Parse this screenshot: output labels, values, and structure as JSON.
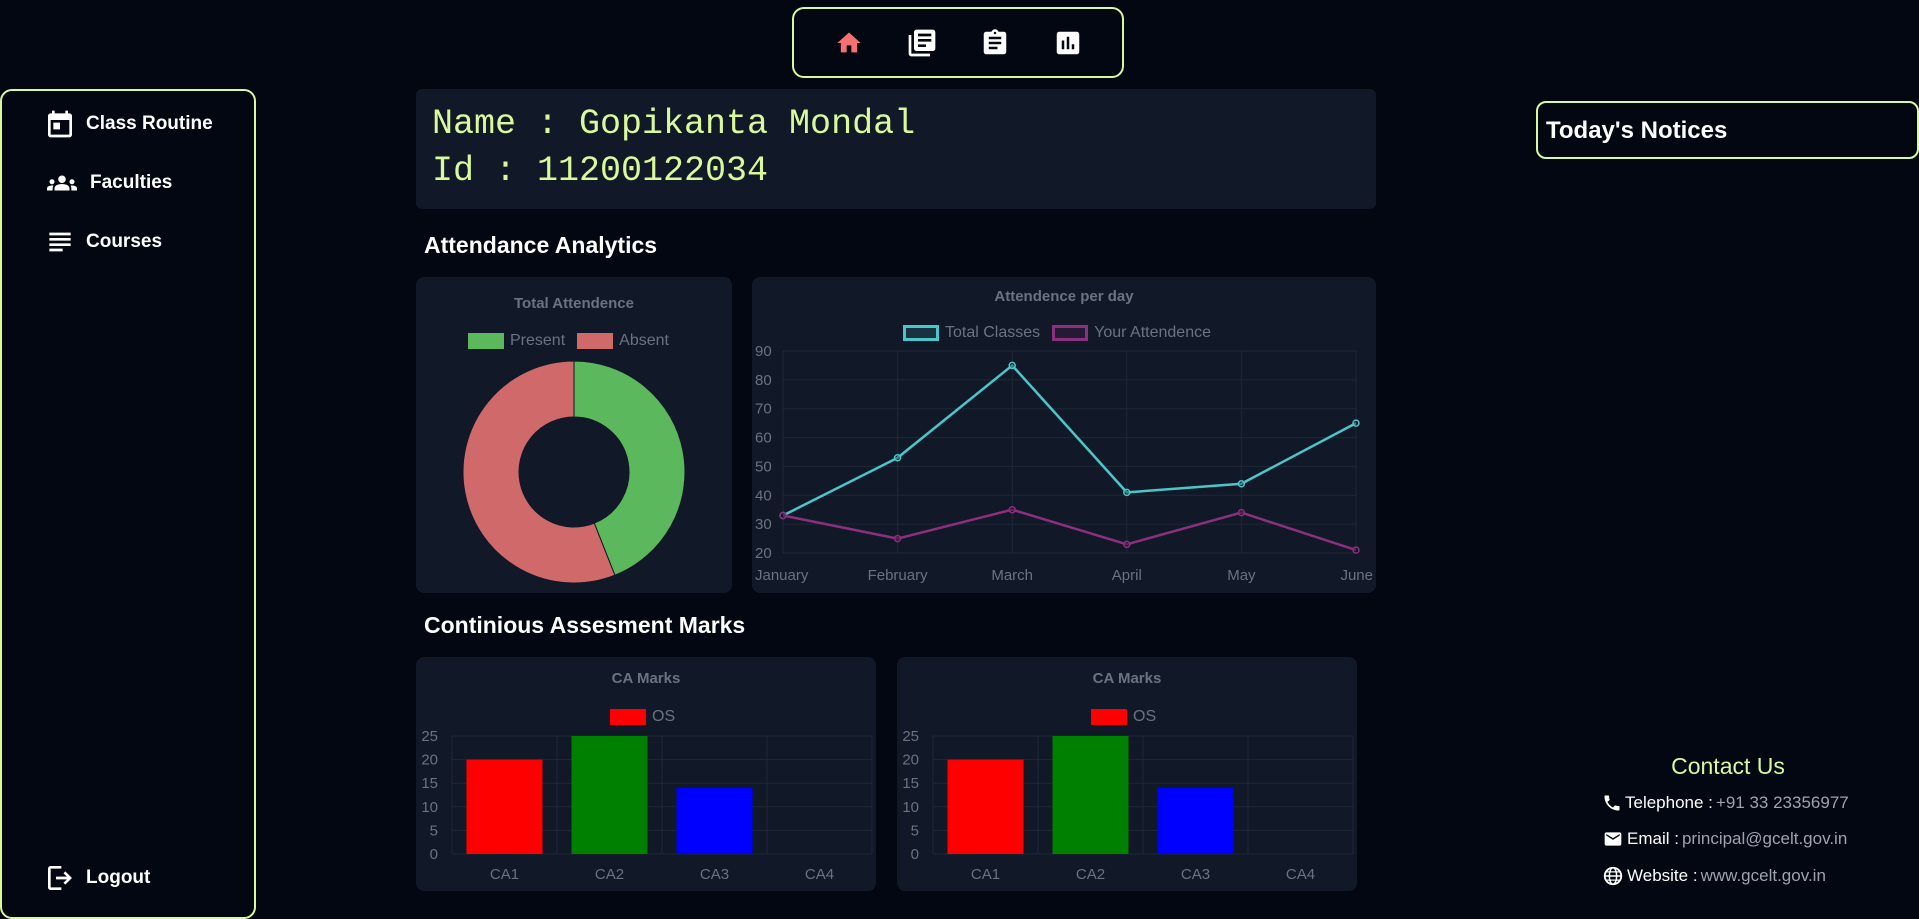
{
  "nav": {
    "icons": [
      "home-icon",
      "library-books-icon",
      "clipboard-icon",
      "bar-chart-icon"
    ],
    "active_color": "#f87171"
  },
  "sidebar": {
    "items": [
      {
        "label": "Class Routine",
        "icon": "calendar-icon"
      },
      {
        "label": "Faculties",
        "icon": "people-icon"
      },
      {
        "label": "Courses",
        "icon": "list-icon"
      }
    ],
    "logout": {
      "label": "Logout",
      "icon": "logout-icon"
    }
  },
  "profile": {
    "name_line": "Name : Gopikanta Mondal",
    "id_line": "Id : 11200122034"
  },
  "sections": {
    "attendance": "Attendance Analytics",
    "ca": "Continious Assesment Marks"
  },
  "notices": {
    "title": "Today's Notices"
  },
  "contact": {
    "title": "Contact Us",
    "telephone_label": "Telephone :",
    "telephone": "+91 33 23356977",
    "email_label": "Email :",
    "email": "principal@gcelt.gov.in",
    "website_label": "Website :",
    "website": "www.gcelt.gov.in"
  },
  "colors": {
    "accent": "#d9f99d",
    "present": "#5cb85c",
    "absent": "#d06a6a",
    "total_classes": "#4ac6c9",
    "your_attendance": "#8b2f7e",
    "ca1": "#ff0000",
    "ca2": "#008000",
    "ca3": "#0000ff"
  },
  "chart_data": [
    {
      "type": "pie",
      "title": "Total Attendence",
      "labels": [
        "Present",
        "Absent"
      ],
      "values": [
        44,
        56
      ],
      "legend": "top"
    },
    {
      "type": "line",
      "title": "Attendence per day",
      "categories": [
        "January",
        "February",
        "March",
        "April",
        "May",
        "June"
      ],
      "series": [
        {
          "name": "Total Classes",
          "values": [
            33,
            53,
            85,
            41,
            44,
            65
          ]
        },
        {
          "name": "Your Attendence",
          "values": [
            33,
            25,
            35,
            23,
            34,
            21
          ]
        }
      ],
      "ylim": [
        20,
        90
      ],
      "yticks": [
        20,
        30,
        40,
        50,
        60,
        70,
        80,
        90
      ],
      "grid": true,
      "legend": "top"
    },
    {
      "type": "bar",
      "title": "CA Marks",
      "categories": [
        "CA1",
        "CA2",
        "CA3",
        "CA4"
      ],
      "series": [
        {
          "name": "OS",
          "values": [
            20,
            25,
            14,
            0
          ]
        }
      ],
      "ylim": [
        0,
        25
      ],
      "yticks": [
        0,
        5,
        10,
        15,
        20,
        25
      ],
      "grid": true,
      "legend": "top"
    },
    {
      "type": "bar",
      "title": "CA Marks",
      "categories": [
        "CA1",
        "CA2",
        "CA3",
        "CA4"
      ],
      "series": [
        {
          "name": "OS",
          "values": [
            20,
            25,
            14,
            0
          ]
        }
      ],
      "ylim": [
        0,
        25
      ],
      "yticks": [
        0,
        5,
        10,
        15,
        20,
        25
      ],
      "grid": true,
      "legend": "top"
    }
  ]
}
